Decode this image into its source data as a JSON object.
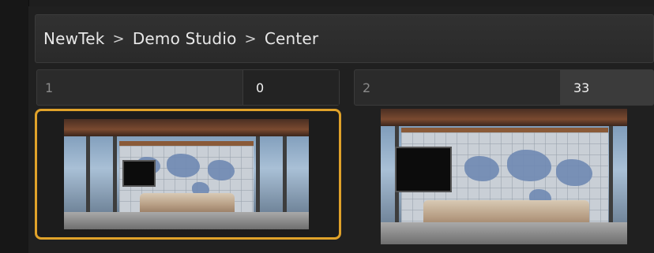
{
  "breadcrumb": {
    "items": [
      "NewTek",
      "Demo Studio",
      "Center"
    ],
    "separator": ">"
  },
  "slots": [
    {
      "number": "1",
      "value": "0",
      "selected": true
    },
    {
      "number": "2",
      "value": "33",
      "selected": false
    }
  ],
  "colors": {
    "selection_border": "#e0a22a",
    "panel_background": "#202020"
  }
}
